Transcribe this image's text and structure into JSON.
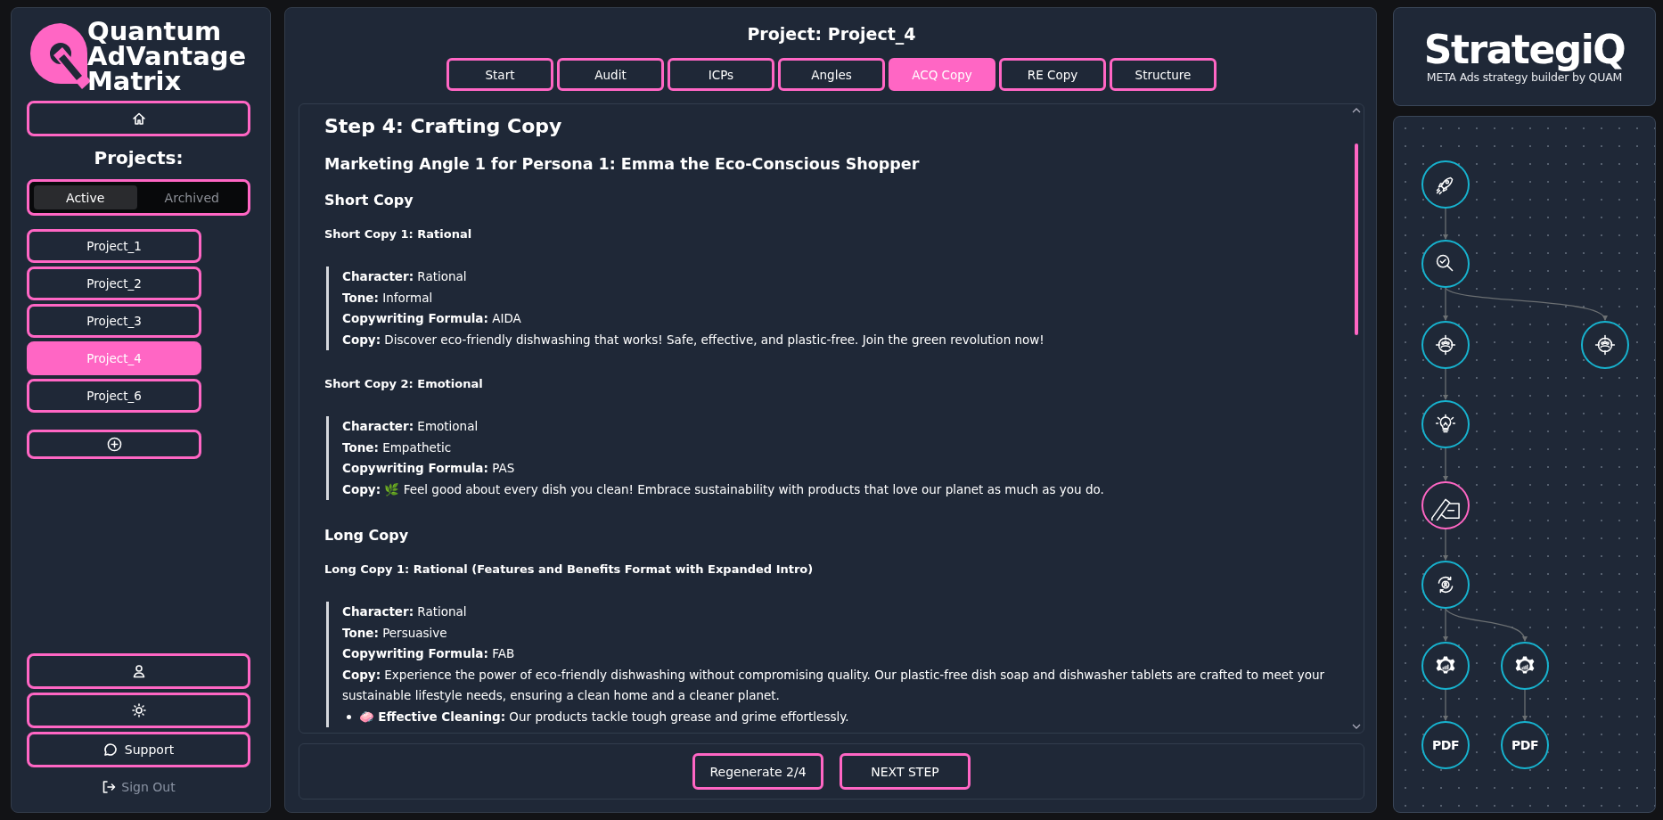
{
  "sidebar": {
    "logo_lines": [
      "Quantum",
      "AdVantage",
      "Matrix"
    ],
    "projects_heading": "Projects:",
    "filter_tabs": [
      {
        "label": "Active",
        "selected": true
      },
      {
        "label": "Archived",
        "selected": false
      }
    ],
    "projects": [
      {
        "label": "Project_1",
        "selected": false
      },
      {
        "label": "Project_2",
        "selected": false
      },
      {
        "label": "Project_3",
        "selected": false
      },
      {
        "label": "Project_4",
        "selected": true
      },
      {
        "label": "Project_6",
        "selected": false
      }
    ],
    "support_label": "Support",
    "sign_out_label": "Sign Out"
  },
  "main": {
    "title": "Project: Project_4",
    "tabs": [
      {
        "label": "Start",
        "selected": false
      },
      {
        "label": "Audit",
        "selected": false
      },
      {
        "label": "ICPs",
        "selected": false
      },
      {
        "label": "Angles",
        "selected": false
      },
      {
        "label": "ACQ Copy",
        "selected": true
      },
      {
        "label": "RE Copy",
        "selected": false
      },
      {
        "label": "Structure",
        "selected": false
      }
    ],
    "content": [
      {
        "kind": "h1",
        "text": "Step 4: Crafting Copy"
      },
      {
        "kind": "h2",
        "text": "Marketing Angle 1 for Persona 1: Emma the Eco-Conscious Shopper"
      },
      {
        "kind": "h3",
        "text": "Short Copy"
      },
      {
        "kind": "h4",
        "text": "Short Copy 1: Rational"
      },
      {
        "kind": "quote",
        "lines": [
          "**Character:** Rational",
          "**Tone:** Informal",
          "**Copywriting Formula:** AIDA",
          "**Copy:** Discover eco-friendly dishwashing that works! Safe, effective, and plastic-free. Join the green revolution now!"
        ]
      },
      {
        "kind": "h4",
        "text": "Short Copy 2: Emotional"
      },
      {
        "kind": "quote",
        "lines": [
          "**Character:** Emotional",
          "**Tone:** Empathetic",
          "**Copywriting Formula:** PAS",
          "**Copy:** 🌿 Feel good about every dish you clean! Embrace sustainability with products that love our planet as much as you do."
        ]
      },
      {
        "kind": "h3",
        "text": "Long Copy"
      },
      {
        "kind": "h4",
        "text": "Long Copy 1: Rational (Features and Benefits Format with Expanded Intro)"
      },
      {
        "kind": "quote",
        "lines": [
          "**Character:** Rational",
          "**Tone:** Persuasive",
          "**Copywriting Formula:** FAB",
          "**Copy:** Experience the power of eco-friendly dishwashing without compromising quality. Our plastic-free dish soap and dishwasher tablets are crafted to meet your sustainable lifestyle needs, ensuring a clean home and a cleaner planet."
        ],
        "bullets": [
          "🧼 **Effective Cleaning:** Our products tackle tough grease and grime effortlessly."
        ]
      }
    ],
    "buttons": [
      "Regenerate 2/4",
      "NEXT STEP"
    ]
  },
  "brand": {
    "name": "StrategiQ",
    "tagline": "META Ads strategy builder by QUAM"
  },
  "flow": {
    "nodes": [
      {
        "selected": false
      },
      {
        "selected": false
      },
      {
        "selected": false
      },
      {
        "selected": false
      },
      {
        "selected": false
      },
      {
        "selected": true
      },
      {
        "selected": false
      },
      {
        "selected": false
      },
      {
        "selected": false
      },
      {
        "label": "PDF",
        "selected": false
      },
      {
        "label": "PDF",
        "selected": false
      }
    ]
  }
}
